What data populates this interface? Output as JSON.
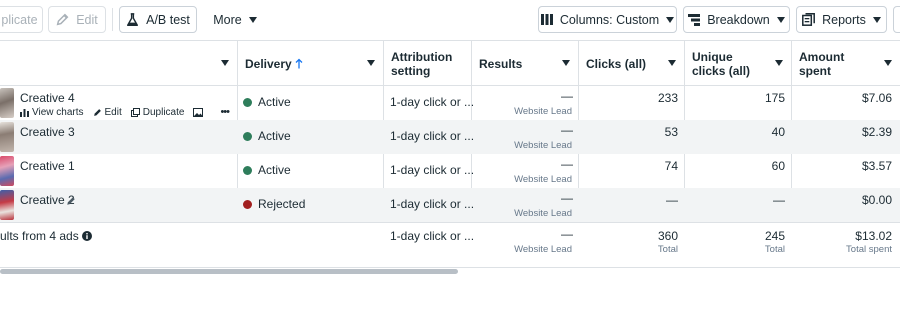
{
  "toolbar": {
    "duplicate_label": "plicate",
    "edit_label": "Edit",
    "ab_test_label": "A/B test",
    "more_label": "More",
    "columns_label": "Columns: Custom",
    "breakdown_label": "Breakdown",
    "reports_label": "Reports"
  },
  "columns": {
    "delivery": "Delivery",
    "attribution": "Attribution setting",
    "results": "Results",
    "clicks": "Clicks (all)",
    "unique_clicks": "Unique clicks (all)",
    "amount_spent": "Amount spent"
  },
  "row_actions": {
    "view_charts": "View charts",
    "edit": "Edit",
    "duplicate": "Duplicate",
    "more": "•••"
  },
  "rows": [
    {
      "name": "Creative 4",
      "delivery": "Active",
      "status_color": "#2e7d5b",
      "attribution": "1-day click or ...",
      "results": "—",
      "results_type": "Website Lead",
      "clicks": "233",
      "unique_clicks": "175",
      "amount_spent": "$7.06"
    },
    {
      "name": "Creative 3",
      "delivery": "Active",
      "status_color": "#2e7d5b",
      "attribution": "1-day click or ...",
      "results": "—",
      "results_type": "Website Lead",
      "clicks": "53",
      "unique_clicks": "40",
      "amount_spent": "$2.39"
    },
    {
      "name": "Creative 1",
      "delivery": "Active",
      "status_color": "#2e7d5b",
      "attribution": "1-day click or ...",
      "results": "—",
      "results_type": "Website Lead",
      "clicks": "74",
      "unique_clicks": "60",
      "amount_spent": "$3.57"
    },
    {
      "name": "Creative 2",
      "delivery": "Rejected",
      "status_color": "#a11f1f",
      "attribution": "1-day click or ...",
      "results": "—",
      "results_type": "Website Lead",
      "clicks": "—",
      "unique_clicks": "—",
      "amount_spent": "$0.00"
    }
  ],
  "totals": {
    "label": "ults from 4 ads",
    "attribution": "1-day click or ...",
    "results": "—",
    "results_type": "Website Lead",
    "clicks": "360",
    "clicks_sub": "Total",
    "unique_clicks": "245",
    "unique_clicks_sub": "Total",
    "amount_spent": "$13.02",
    "amount_spent_sub": "Total spent"
  },
  "colors": {
    "accent": "#1877f2",
    "active": "#2e7d5b",
    "rejected": "#a11f1f"
  }
}
